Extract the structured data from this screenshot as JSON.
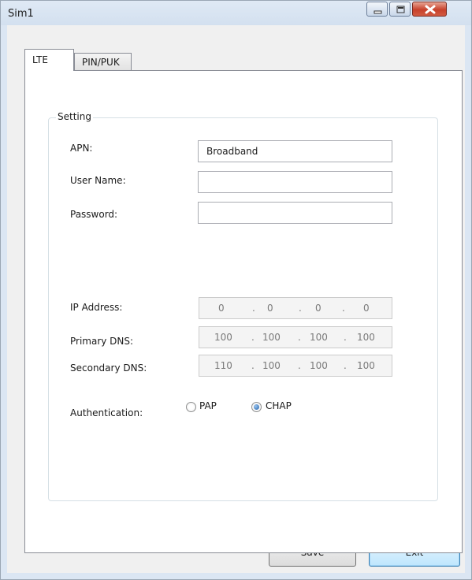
{
  "window": {
    "title": "Sim1"
  },
  "tabs": [
    {
      "label": "LTE",
      "selected": true
    },
    {
      "label": "PIN/PUK",
      "selected": false
    }
  ],
  "setting_group": {
    "legend": "Setting",
    "apn": {
      "label": "APN:",
      "value": "Broadband"
    },
    "user_name": {
      "label": "User Name:",
      "value": ""
    },
    "password": {
      "label": "Password:",
      "value": ""
    },
    "ip_address": {
      "label": "IP Address:",
      "octets": [
        "0",
        "0",
        "0",
        "0"
      ]
    },
    "primary_dns": {
      "label": "Primary DNS:",
      "octets": [
        "100",
        "100",
        "100",
        "100"
      ]
    },
    "secondary_dns": {
      "label": "Secondary DNS:",
      "octets": [
        "110",
        "100",
        "100",
        "100"
      ]
    },
    "authentication": {
      "label": "Authentication:",
      "options": [
        {
          "label": "PAP",
          "selected": false
        },
        {
          "label": "CHAP",
          "selected": true
        }
      ]
    }
  },
  "buttons": {
    "save": "Save",
    "exit": "Exit"
  },
  "colors": {
    "title_bar": "#d7e3f1",
    "close_button": "#c7412b",
    "default_button_border": "#3c7fb1"
  }
}
